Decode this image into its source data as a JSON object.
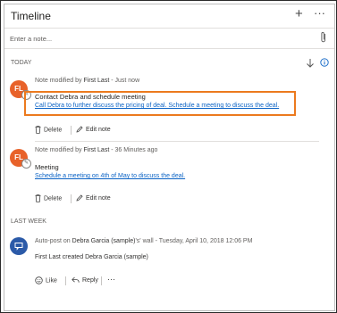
{
  "header": {
    "title": "Timeline",
    "add_glyph": "+",
    "more_glyph": "···"
  },
  "note_input": {
    "placeholder": "Enter a note..."
  },
  "sections": {
    "today": "TODAY",
    "last_week": "LAST WEEK"
  },
  "icons": [
    "paperclip-icon",
    "filter-arrow-icon",
    "info-icon",
    "trash-icon",
    "pencil-icon",
    "like-icon",
    "reply-icon",
    "post-icon"
  ],
  "entries": [
    {
      "avatar": "FL",
      "avatar_color": "#e8622a",
      "meta_prefix": "Note modified by",
      "meta_author": "First Last",
      "meta_time": "- Just now",
      "title": "Contact Debra and schedule meeting",
      "body": "Call Debra to further discuss the pricing of deal. Schedule a meeting to discuss the deal.",
      "delete_label": "Delete",
      "edit_label": "Edit note"
    },
    {
      "avatar": "FL",
      "avatar_color": "#e8622a",
      "meta_prefix": "Note modified by",
      "meta_author": "First Last",
      "meta_time": "- 36 Minutes ago",
      "title": "Meeting",
      "body": "Schedule a meeting on 4th of May to discuss the deal.",
      "delete_label": "Delete",
      "edit_label": "Edit note"
    }
  ],
  "post": {
    "avatar_color": "#2b5aa8",
    "meta_prefix": "Auto-post on",
    "meta_target": "Debra Garcia (sample)",
    "meta_suffix": "'s' wall -",
    "meta_time": "Tuesday, April 10, 2018 12:06 PM",
    "line_author": "First Last",
    "line_mid": "created",
    "line_target": "Debra Garcia (sample)",
    "like_label": "Like",
    "reply_label": "Reply",
    "more_glyph": "···"
  },
  "colors": {
    "accent_link": "#0b63c5",
    "highlight": "#ec7a1e",
    "avatar_fl": "#e8622a",
    "avatar_post": "#2b5aa8"
  }
}
